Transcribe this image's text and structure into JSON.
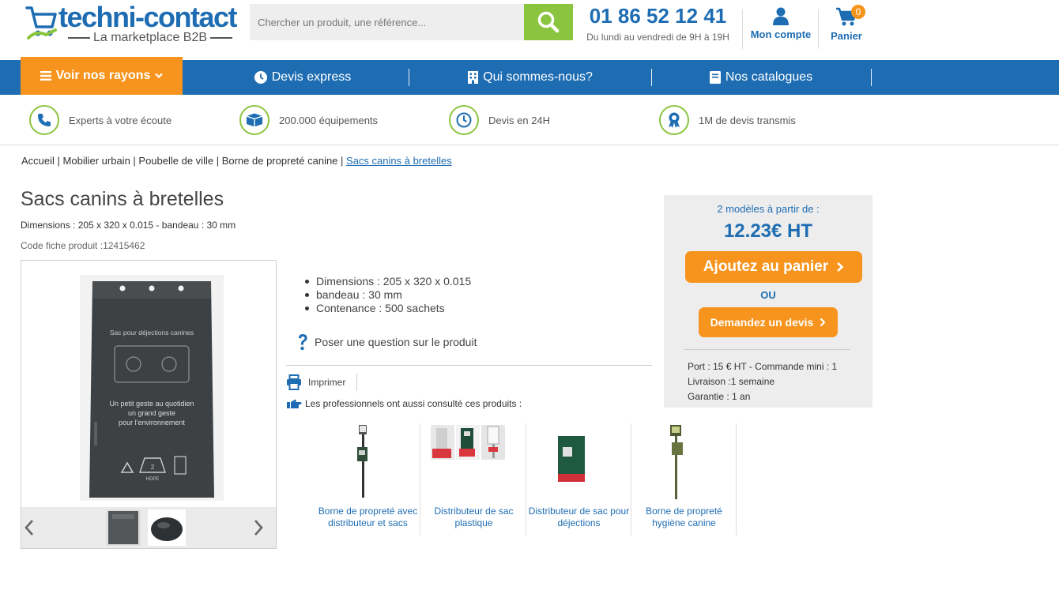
{
  "header": {
    "logo_name": "techni-contact",
    "logo_sub": "La marketplace B2B",
    "search_placeholder": "Chercher un produit, une référence...",
    "phone": "01 86 52 12 41",
    "hours": "Du lundi au vendredi de 9H à 19H",
    "account_label": "Mon compte",
    "cart_label": "Panier",
    "cart_count": "0"
  },
  "nav": {
    "rayons_label": "Voir nos rayons",
    "items": [
      "Devis express",
      "Qui sommes-nous?",
      "Nos catalogues"
    ]
  },
  "features": [
    {
      "label": "Experts à votre écoute",
      "icon": "phone-icon"
    },
    {
      "label": "200.000 équipements",
      "icon": "box-icon"
    },
    {
      "label": "Devis en 24H",
      "icon": "clock-icon"
    },
    {
      "label": "1M de devis transmis",
      "icon": "award-icon"
    }
  ],
  "breadcrumb": {
    "items": [
      "Accueil",
      "Mobilier urbain",
      "Poubelle de ville",
      "Borne de propreté canine"
    ],
    "current": "Sacs canins à bretelles",
    "separator": " | "
  },
  "product": {
    "title": "Sacs canins à bretelles",
    "dimensions": "Dimensions : 205 x 320 x 0.015 - bandeau : 30 mm",
    "code": "Code fiche produit :12415462",
    "bullets": [
      "Dimensions : 205 x 320 x 0.015",
      "bandeau : 30 mm",
      "Contenance : 500 sachets"
    ],
    "question": "Poser une question sur le produit",
    "print": "Imprimer",
    "also_viewed": "Les professionnels ont aussi consulté ces produits :",
    "bag_text": {
      "top": "Sac pour déjections canines",
      "slogan1": "Un petit geste au quotidien",
      "slogan2": "un grand geste",
      "slogan3": "pour l'environnement",
      "recycle": "2",
      "material": "HDPE"
    }
  },
  "related": [
    {
      "label": "Borne de propreté avec distributeur et sacs"
    },
    {
      "label": "Distributeur de sac plastique"
    },
    {
      "label": "Distributeur de sac pour déjections"
    },
    {
      "label": "Borne de propreté hygiène canine"
    }
  ],
  "pricebox": {
    "from": "2 modèles à partir de :",
    "price": "12.23€ HT",
    "cart_button": "Ajoutez au panier",
    "or": "OU",
    "devis_button": "Demandez un devis",
    "shipping": "Port : 15 € HT - Commande mini : 1",
    "delivery": "Livraison :1 semaine",
    "warranty": "Garantie : 1 an"
  },
  "colors": {
    "blue": "#1e6db3",
    "orange": "#f7941d",
    "green": "#8bc53f"
  }
}
